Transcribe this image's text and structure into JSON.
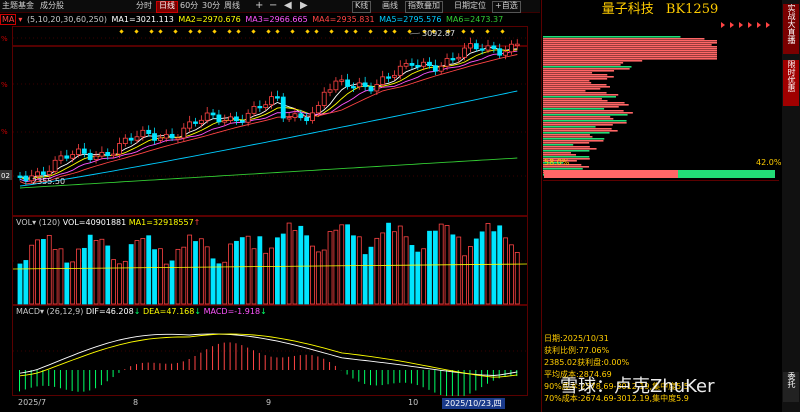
{
  "toolbar": {
    "left_items": [
      "主题基金",
      "成分股"
    ],
    "period_buttons": [
      "分时",
      "日线",
      "60分",
      "30分",
      "周线"
    ],
    "active_period": "日线",
    "tool_buttons": [
      "+",
      "−",
      "K线",
      "画线",
      "指数叠加",
      "日期定位",
      "+自选"
    ],
    "arrow_left": "◀",
    "arrow_right": "▶"
  },
  "indicator_line": {
    "ma_label": "MA",
    "params": "(5,10,20,30,60,250)",
    "ma1": "MA1=3021.113",
    "ma2": "MA2=2970.676",
    "ma3": "MA3=2966.665",
    "ma4": "MA4=2935.831",
    "ma5": "MA5=2795.576",
    "ma6": "MA6=2473.37",
    "colors": {
      "ma1": "#ffffff",
      "ma2": "#ffff00",
      "ma3": "#ff55ff",
      "ma4": "#ff4444",
      "ma5": "#00ccff",
      "ma6": "#33cc33"
    }
  },
  "price_chart": {
    "high_label": "3092.87",
    "low_label": "2355.50",
    "left_axis_labels": [
      "%",
      "%",
      "%",
      "%",
      "02"
    ],
    "up_color": "#ff4444",
    "down_color": "#00e5ff"
  },
  "volume": {
    "label": "VOL",
    "params": "(120)",
    "vol": "VOL=40901881",
    "ma1": "MA1=32918557",
    "up_arrow": "↑"
  },
  "macd": {
    "label": "MACD",
    "params": "(26,12,9)",
    "dif": "DIF=46.208",
    "dea": "DEA=47.168",
    "macd": "MACD=-1.918",
    "dif_arrow": "↓",
    "dea_arrow": "↓",
    "macd_arrow": "↓"
  },
  "date_axis": {
    "labels": [
      "2025/7",
      "8",
      "9",
      "10"
    ],
    "cursor_date": "2025/10/23,四"
  },
  "right_panel": {
    "title": "量子科技",
    "code": "BK1259",
    "pct_left": "58.0%",
    "pct_right": "42.0%",
    "stats": {
      "date": "日期:2025/10/31",
      "profit_ratio": "获利比例:77.06%",
      "profit_line": "2385.02获利盘:0.00%",
      "avg_cost": "平均成本:2874.69",
      "cost90": "90%成本:2578.69-3012.19,集中度5.5",
      "cost70": "70%成本:2674.69-3012.19,集中度5.9"
    }
  },
  "side_tabs": {
    "tab1": "实战大直播",
    "tab2": "限时优惠",
    "tab3": "委托"
  },
  "watermark": "雪球：卢克ZhuKer"
}
